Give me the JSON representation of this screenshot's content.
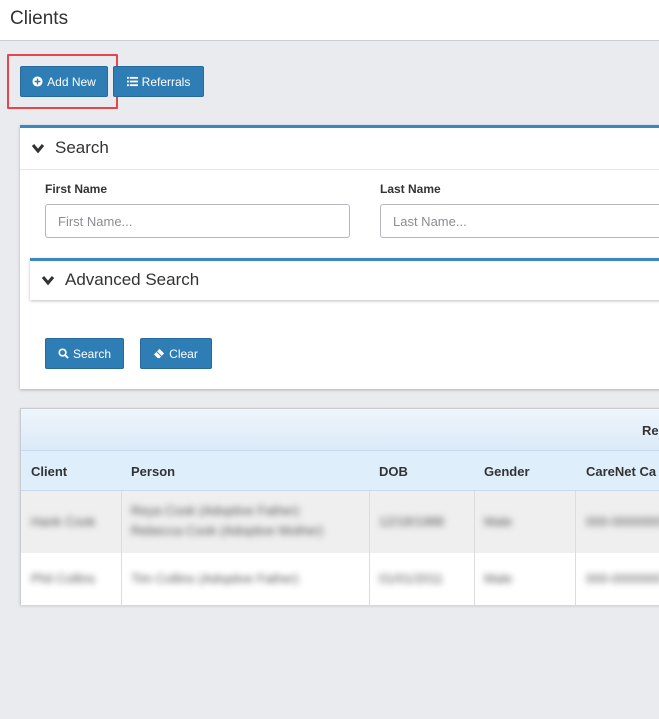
{
  "page": {
    "title": "Clients"
  },
  "toolbar": {
    "add_new_label": "Add New",
    "referrals_label": "Referrals"
  },
  "search": {
    "title": "Search",
    "first_name_label": "First Name",
    "first_name_placeholder": "First Name...",
    "last_name_label": "Last Name",
    "last_name_placeholder": "Last Name...",
    "advanced_title": "Advanced Search",
    "search_button": "Search",
    "clear_button": "Clear"
  },
  "grid": {
    "top_text": "Re",
    "columns": [
      "Client",
      "Person",
      "DOB",
      "Gender",
      "CareNet Ca"
    ],
    "rows": [
      {
        "client": "Hank Cook",
        "person": [
          "Reya Cook (Adoptive Father)",
          "Rebecca Cook (Adoptive Mother)"
        ],
        "dob": "12/18/1988",
        "gender": "Male",
        "carenet": "000-0000000"
      },
      {
        "client": "Phil Collins",
        "person": [
          "Tim Collins (Adoptive Father)"
        ],
        "dob": "01/01/2011",
        "gender": "Male",
        "carenet": "000-0000000"
      }
    ]
  },
  "colors": {
    "primary": "#2f7db5",
    "panel_accent": "#3b87c2",
    "highlight": "#e4464b",
    "background": "#e9ebef"
  }
}
